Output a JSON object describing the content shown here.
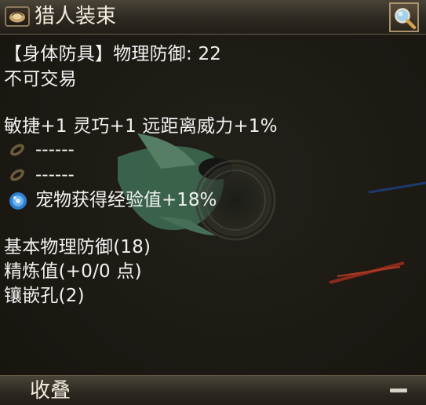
{
  "window": {
    "title": "猎人装束",
    "icon": "bag-icon",
    "search_icon": "magnifier-icon"
  },
  "item": {
    "type_line": "【身体防具】物理防御: 22",
    "trade": "不可交易",
    "bonus": "敏捷+1 灵巧+1 远距离威力+1%",
    "sockets": [
      {
        "icon": "feather-socket-icon",
        "text": "------"
      },
      {
        "icon": "feather-socket-icon",
        "text": "------"
      },
      {
        "icon": "blue-gem-icon",
        "text": "宠物获得经验值+18%"
      }
    ],
    "base_defense": "基本物理防御(18)",
    "refine": "精炼值(+0/0 点)",
    "slots": "镶嵌孔(2)"
  },
  "footer": {
    "label": "收叠",
    "collapse_icon": "minus-icon"
  },
  "colors": {
    "text": "#f2f2f2",
    "panel_border": "#6a5e48",
    "gem_blue": "#2e7fd1"
  }
}
